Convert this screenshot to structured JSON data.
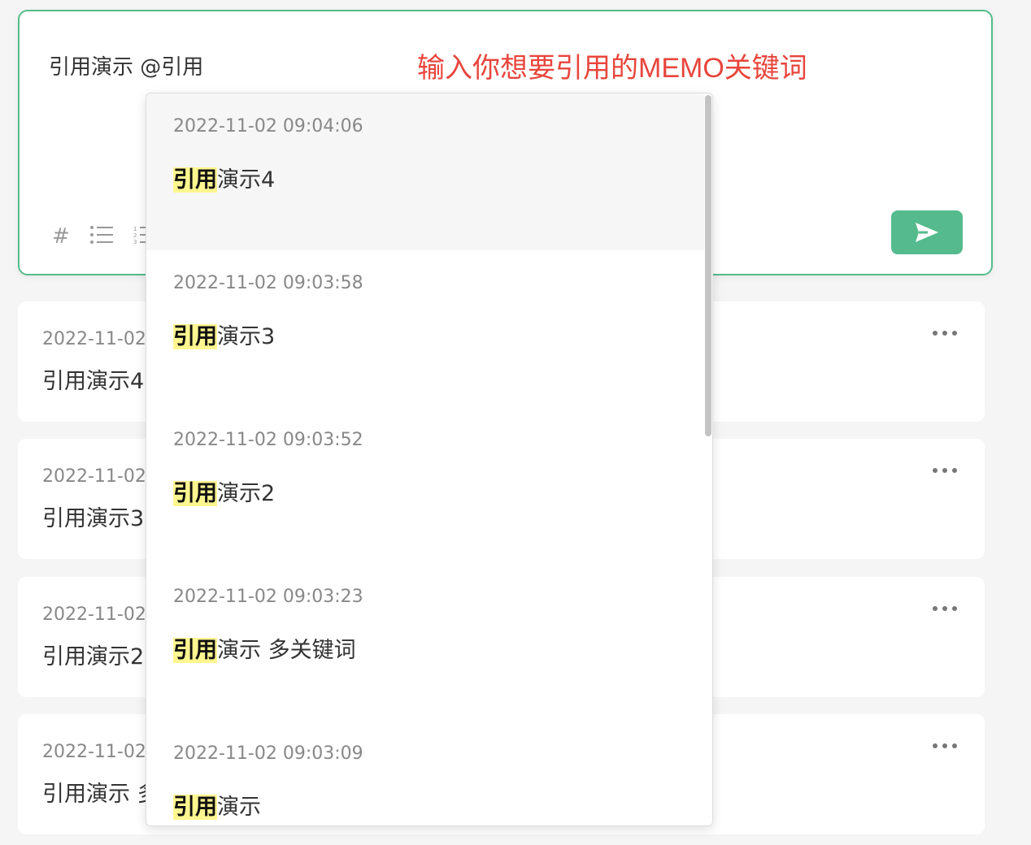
{
  "editor": {
    "text": "引用演示 @引用",
    "annotation": "输入你想要引用的MEMO关键词",
    "toolbar": {
      "tag_icon": "#",
      "list_icon": "bullet-list-icon",
      "ordered_list_icon": "ordered-list-icon"
    },
    "send_icon": "send-icon"
  },
  "memos": [
    {
      "date": "2022-11-02",
      "content": "引用演示4"
    },
    {
      "date": "2022-11-02",
      "content": "引用演示3"
    },
    {
      "date": "2022-11-02",
      "content": "引用演示2"
    },
    {
      "date": "2022-11-02",
      "content": "引用演示 多"
    }
  ],
  "dropdown": {
    "items": [
      {
        "date": "2022-11-02 09:04:06",
        "match": "引用",
        "rest": "演示4"
      },
      {
        "date": "2022-11-02 09:03:58",
        "match": "引用",
        "rest": "演示3"
      },
      {
        "date": "2022-11-02 09:03:52",
        "match": "引用",
        "rest": "演示2"
      },
      {
        "date": "2022-11-02 09:03:23",
        "match": "引用",
        "rest": "演示 多关键词"
      },
      {
        "date": "2022-11-02 09:03:09",
        "match": "引用",
        "rest": "演示"
      }
    ]
  },
  "colors": {
    "accent": "#55bb8e",
    "annotation": "#e8453c",
    "highlight": "#fff68f"
  }
}
